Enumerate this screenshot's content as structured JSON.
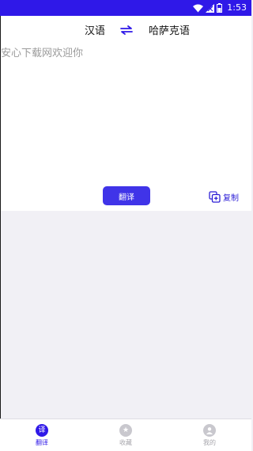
{
  "status_bar": {
    "time": "1:53",
    "icons": [
      "wifi-icon",
      "signal-icon",
      "battery-icon"
    ]
  },
  "header": {
    "source_language": "汉语",
    "target_language": "哈萨克语",
    "swap_icon": "swap-arrows-icon"
  },
  "input": {
    "placeholder": "安心下载网欢迎你",
    "value": ""
  },
  "actions": {
    "translate_label": "翻译",
    "copy_label": "复制",
    "copy_icon": "copy-plus-icon"
  },
  "bottom_nav": {
    "items": [
      {
        "label": "翻译",
        "icon_glyph": "译",
        "icon": "translate-icon",
        "active": true
      },
      {
        "label": "收藏",
        "icon_glyph": "★",
        "icon": "star-icon",
        "active": false
      },
      {
        "label": "我的",
        "icon_glyph": "",
        "icon": "person-icon",
        "active": false
      }
    ]
  },
  "colors": {
    "accent": "#2f18e8",
    "button": "#4034e8",
    "background": "#f1f0f5",
    "inactive": "#c9c8ce"
  }
}
